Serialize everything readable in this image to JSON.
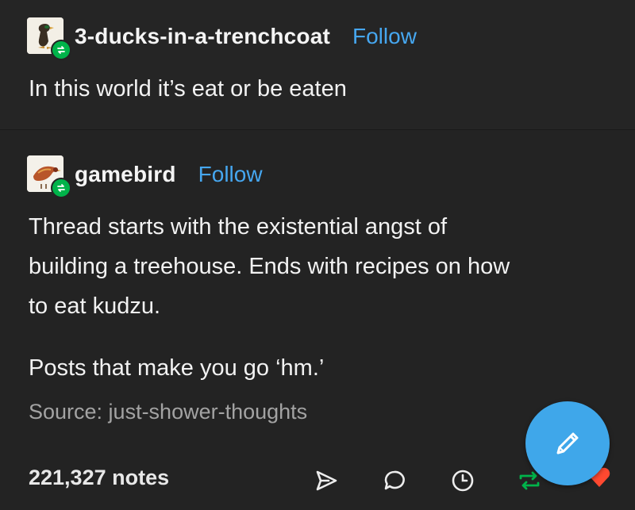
{
  "post1": {
    "username": "3-ducks-in-a-trenchcoat",
    "follow_label": "Follow",
    "text": "In this world it’s eat or be eaten"
  },
  "post2": {
    "username": "gamebird",
    "follow_label": "Follow",
    "paragraph1_line1": "Thread starts with the existential angst of",
    "paragraph1_line2": "building a treehouse. Ends with recipes on how",
    "paragraph1_line3": "to eat kudzu.",
    "paragraph2": "Posts that make you go ‘hm.’",
    "source": "Source: just-shower-thoughts"
  },
  "footer": {
    "notes": "221,327 notes",
    "icons": [
      "share-icon",
      "reply-icon",
      "clock-icon",
      "reblog-icon",
      "like-icon"
    ]
  },
  "fab": {
    "icon": "pencil-icon"
  },
  "colors": {
    "background": "#232323",
    "text": "#f2f2f2",
    "follow": "#46a7f0",
    "source": "#a3a3a3",
    "reblog_green": "#00b34a",
    "fab_blue": "#3fa7ea",
    "heart_red": "#ff4930"
  }
}
